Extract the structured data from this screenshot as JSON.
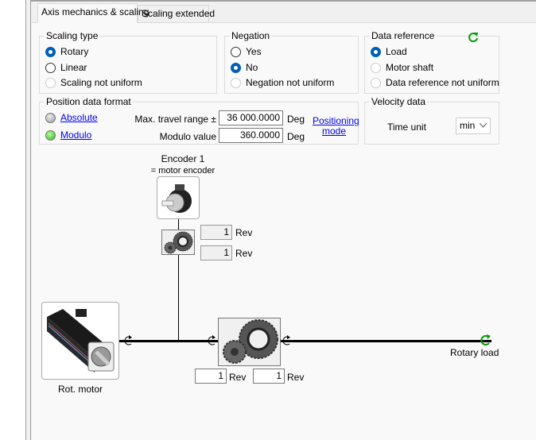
{
  "tabs": [
    {
      "label": "Axis mechanics & scaling",
      "active": true
    },
    {
      "label": "Scaling extended",
      "active": false
    }
  ],
  "scaling_type": {
    "title": "Scaling type",
    "options": [
      {
        "label": "Rotary",
        "state": "checked"
      },
      {
        "label": "Linear",
        "state": "unchecked"
      },
      {
        "label": "Scaling not uniform",
        "state": "disabled"
      }
    ]
  },
  "negation": {
    "title": "Negation",
    "options": [
      {
        "label": "Yes",
        "state": "unchecked"
      },
      {
        "label": "No",
        "state": "checked"
      },
      {
        "label": "Negation not uniform",
        "state": "disabled"
      }
    ]
  },
  "data_reference": {
    "title": "Data reference",
    "icon": "refresh-icon",
    "options": [
      {
        "label": "Load",
        "state": "checked"
      },
      {
        "label": "Motor shaft",
        "state": "disabled"
      },
      {
        "label": "Data reference not uniform",
        "state": "disabled"
      }
    ]
  },
  "position_format": {
    "title": "Position data format",
    "absolute": {
      "label": "Absolute",
      "led": "gray"
    },
    "modulo": {
      "label": "Modulo",
      "led": "green"
    },
    "max_travel_label": "Max. travel range ±",
    "max_travel_value": "36 000.0000",
    "max_travel_unit": "Deg",
    "modulo_label": "Modulo value",
    "modulo_value": "360.0000",
    "modulo_unit": "Deg",
    "positioning_mode_line1": "Positioning",
    "positioning_mode_line2": "mode"
  },
  "velocity": {
    "title": "Velocity data",
    "time_unit_label": "Time unit",
    "time_unit_value": "min"
  },
  "diagram": {
    "encoder_line1": "Encoder 1",
    "encoder_line2": "= motor encoder",
    "encoder_gear_in": "1",
    "encoder_gear_out": "1",
    "rev_unit": "Rev",
    "load_gear_in": "1",
    "load_gear_out": "1",
    "motor_label": "Rot. motor",
    "load_label": "Rotary load"
  },
  "colors": {
    "accent": "#005fb8",
    "link": "#0000ee",
    "green": "#0a9a0a"
  }
}
